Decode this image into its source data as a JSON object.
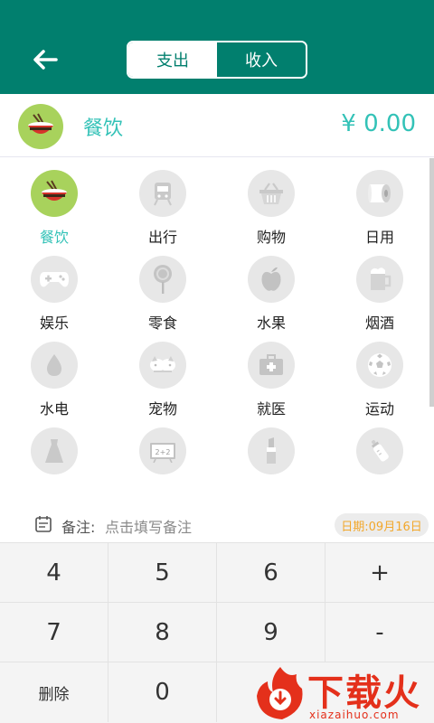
{
  "header": {
    "tabs": [
      {
        "label": "支出",
        "active": true
      },
      {
        "label": "收入",
        "active": false
      }
    ],
    "colors": {
      "primary": "#017f6e",
      "accent": "#33c2b7",
      "selected_icon_bg": "#a8d25c"
    }
  },
  "selected": {
    "name": "餐饮",
    "amount": "¥ 0.00",
    "icon": "rice-bowl-icon"
  },
  "categories": [
    {
      "label": "餐饮",
      "icon": "rice-bowl-icon",
      "active": true
    },
    {
      "label": "出行",
      "icon": "train-icon",
      "active": false
    },
    {
      "label": "购物",
      "icon": "basket-icon",
      "active": false
    },
    {
      "label": "日用",
      "icon": "toilet-paper-icon",
      "active": false
    },
    {
      "label": "娱乐",
      "icon": "gamepad-icon",
      "active": false
    },
    {
      "label": "零食",
      "icon": "lollipop-icon",
      "active": false
    },
    {
      "label": "水果",
      "icon": "apple-icon",
      "active": false
    },
    {
      "label": "烟酒",
      "icon": "beer-icon",
      "active": false
    },
    {
      "label": "水电",
      "icon": "water-drop-icon",
      "active": false
    },
    {
      "label": "宠物",
      "icon": "pet-icon",
      "active": false
    },
    {
      "label": "就医",
      "icon": "medical-kit-icon",
      "active": false
    },
    {
      "label": "运动",
      "icon": "soccer-ball-icon",
      "active": false
    },
    {
      "label": "",
      "icon": "dress-icon",
      "active": false
    },
    {
      "label": "",
      "icon": "blackboard-icon",
      "active": false
    },
    {
      "label": "",
      "icon": "lipstick-icon",
      "active": false
    },
    {
      "label": "",
      "icon": "baby-bottle-icon",
      "active": false
    }
  ],
  "note": {
    "label": "备注:",
    "placeholder": "点击填写备注",
    "date": "日期:09月16日"
  },
  "keypad": {
    "keys": [
      "4",
      "5",
      "6",
      "+",
      "7",
      "8",
      "9",
      "-",
      "删除",
      "0"
    ]
  },
  "watermark": {
    "text": "下载火",
    "sub": "xiazaihuo.com"
  }
}
